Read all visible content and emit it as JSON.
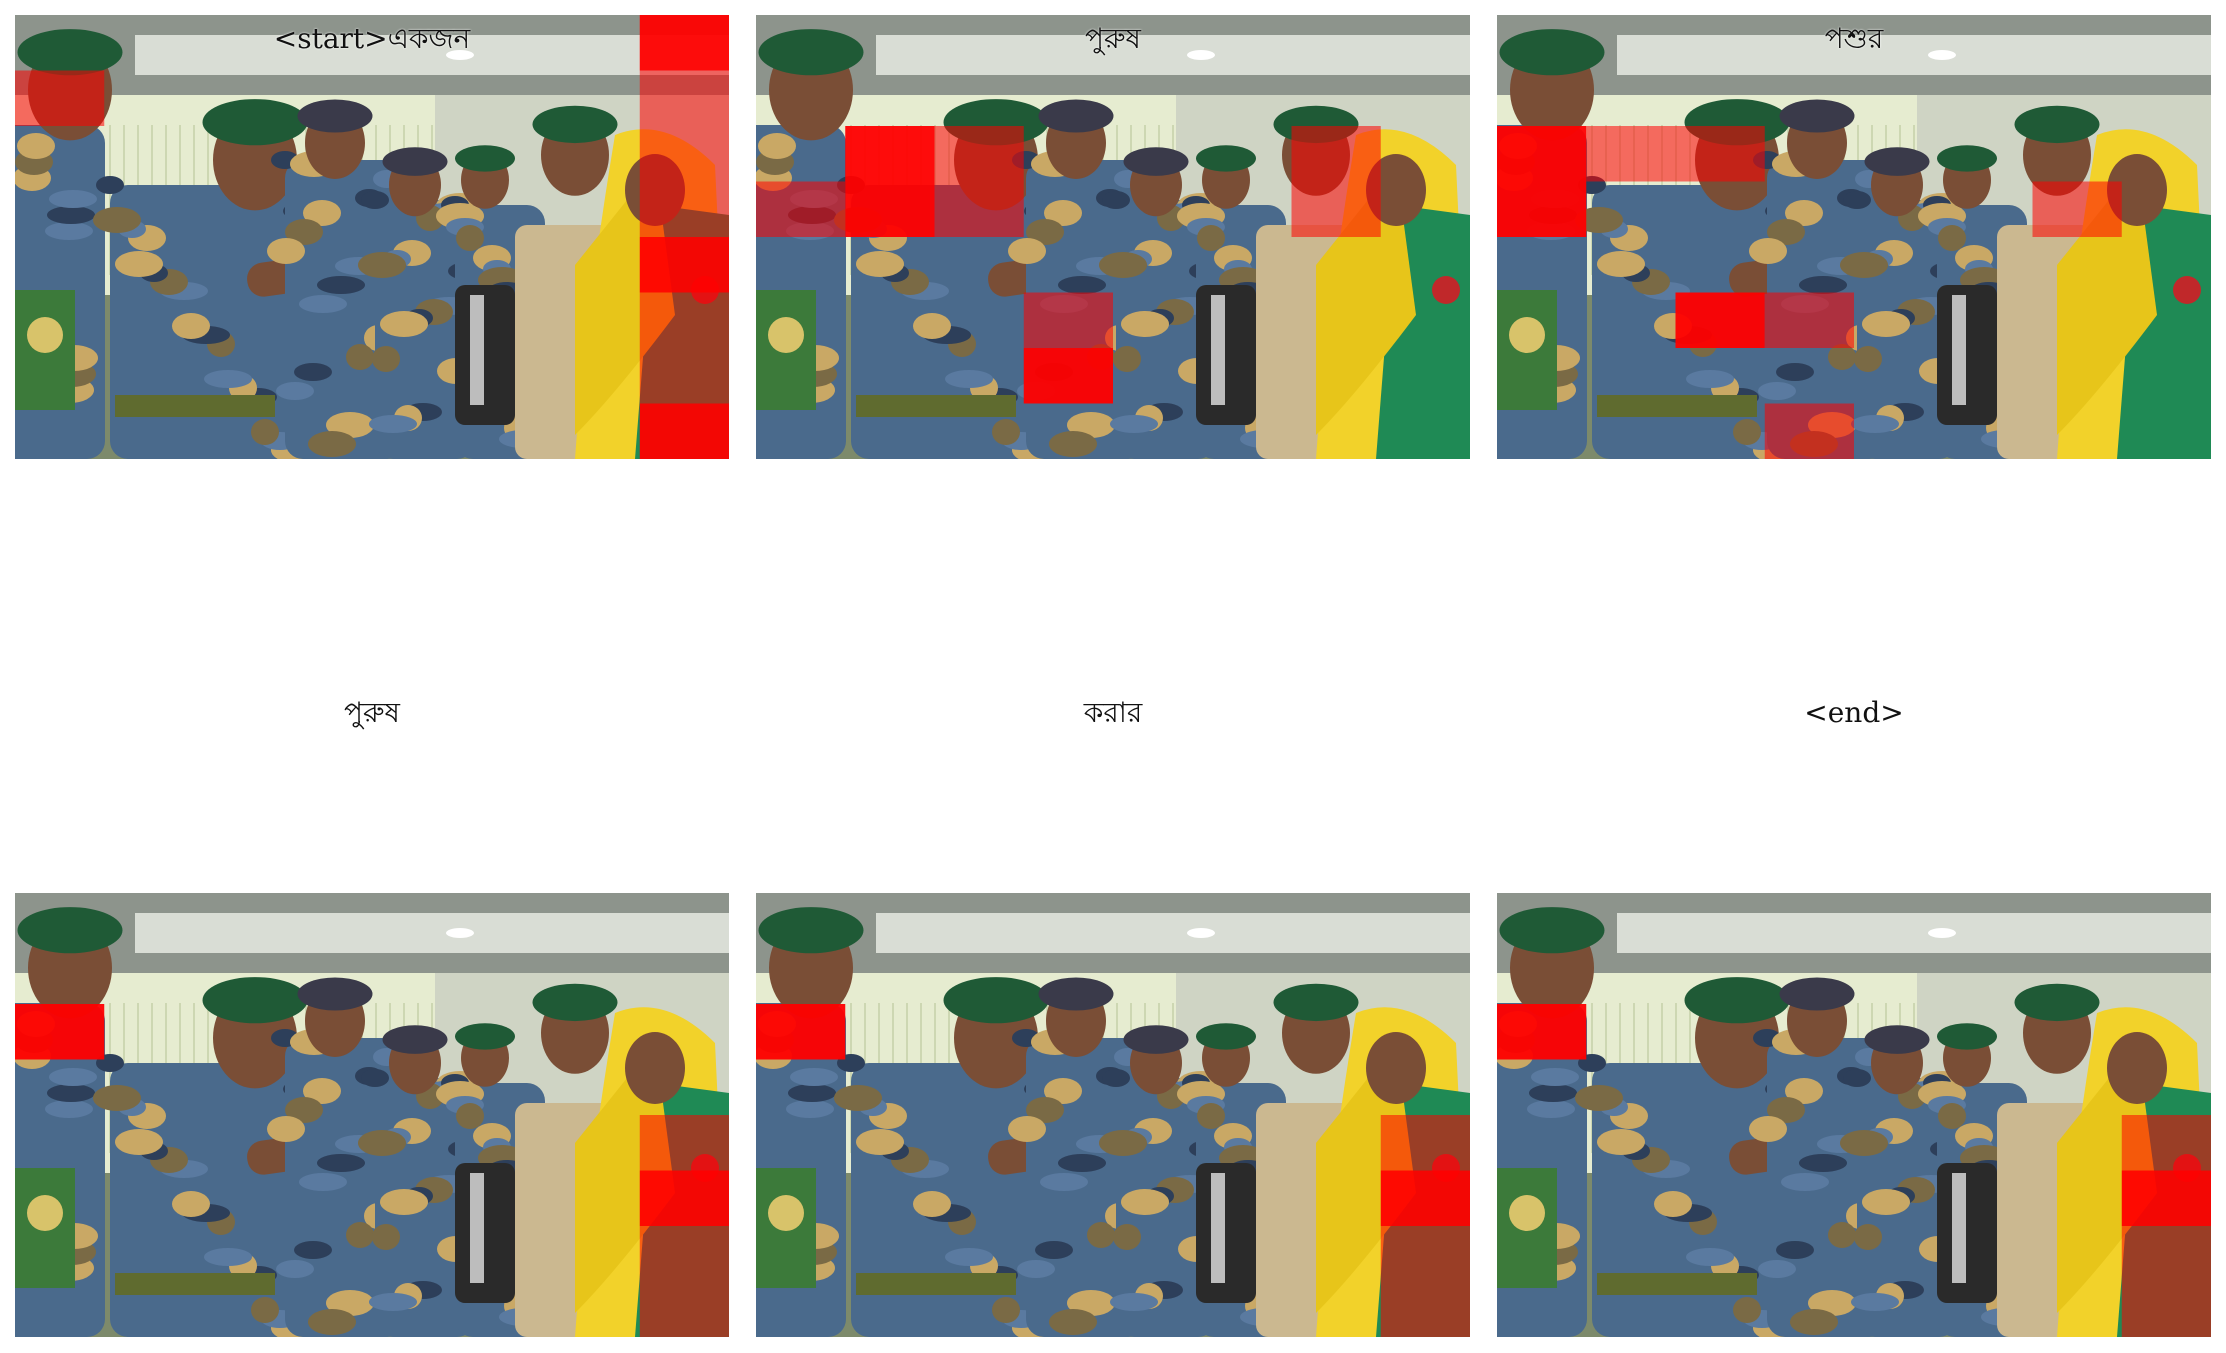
{
  "grid": {
    "top_row": [
      {
        "token": "<start>একজন",
        "focus": [
          "r0c7",
          "r1c7",
          "r3c7",
          "r4c7",
          "r5c7",
          "r6c7",
          "r7c7",
          "r2c7",
          "r1c0"
        ]
      },
      {
        "token": "পুরুষ",
        "focus": [
          "r2c1",
          "r2c2",
          "r3c0",
          "r3c1",
          "r3c2",
          "r5c3",
          "r6c3",
          "r2c6",
          "r3c6"
        ]
      },
      {
        "token": "পশুর",
        "focus": [
          "r2c0",
          "r2c1",
          "r2c2",
          "r3c0",
          "r3c6",
          "r5c3",
          "r5c2",
          "r7c3"
        ]
      }
    ],
    "middle_row": [
      {
        "token": "পুরুষ"
      },
      {
        "token": "করার"
      },
      {
        "token": "<end>"
      }
    ],
    "bottom_row": [
      {
        "token": "",
        "focus": [
          "r2c0",
          "r4c7",
          "r6c7",
          "r5c7",
          "r7c7"
        ]
      },
      {
        "token": "",
        "focus": [
          "r2c0",
          "r4c7",
          "r6c7",
          "r5c7",
          "r7c7"
        ]
      },
      {
        "token": "",
        "focus": [
          "r2c0",
          "r4c7",
          "r6c7",
          "r5c7",
          "r7c7"
        ]
      }
    ]
  },
  "colors": {
    "heat": "#ff0000",
    "uniform_green": "#1f5a36",
    "saree_yellow": "#f2d22a"
  }
}
